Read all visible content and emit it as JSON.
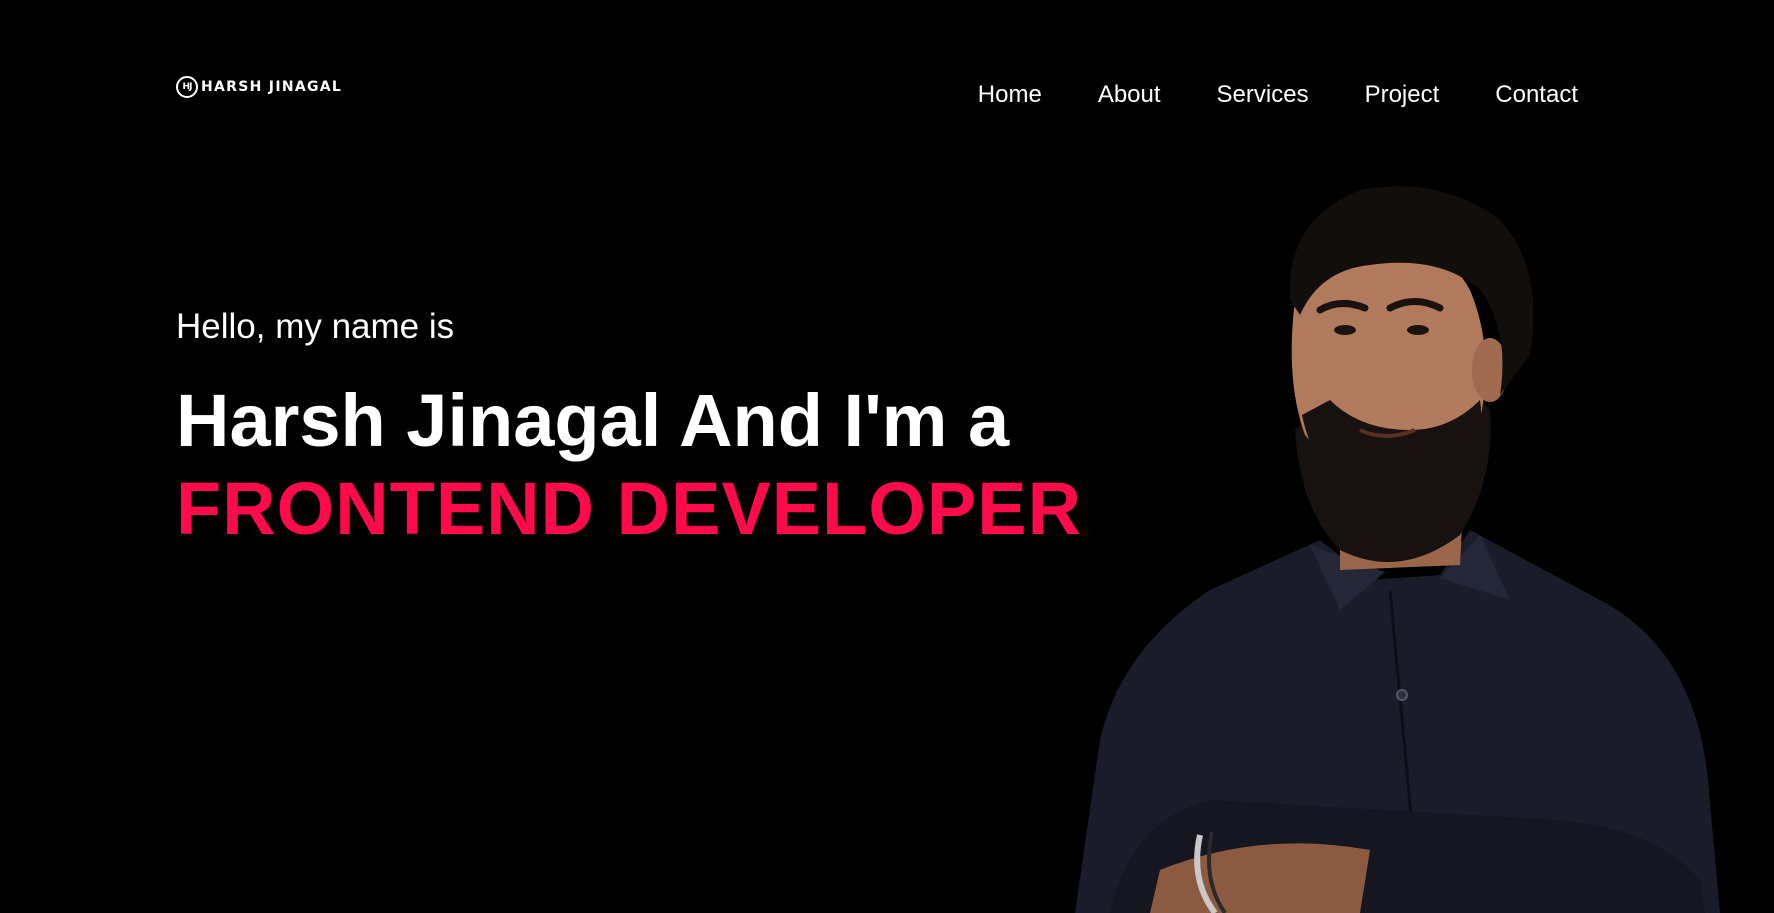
{
  "header": {
    "logo": {
      "mark": "HJ",
      "text": "HARSH JINAGAL"
    },
    "nav": [
      {
        "label": "Home"
      },
      {
        "label": "About"
      },
      {
        "label": "Services"
      },
      {
        "label": "Project"
      },
      {
        "label": "Contact"
      }
    ]
  },
  "hero": {
    "greeting": "Hello, my name is",
    "headline": "Harsh Jinagal And I'm a",
    "role": "FRONTEND DEVELOPER"
  },
  "colors": {
    "background": "#000000",
    "text": "#ffffff",
    "accent": "#ff0a4b",
    "shirt": "#1a1c2a",
    "skin": "#b27a5c",
    "hair": "#120e0c"
  }
}
